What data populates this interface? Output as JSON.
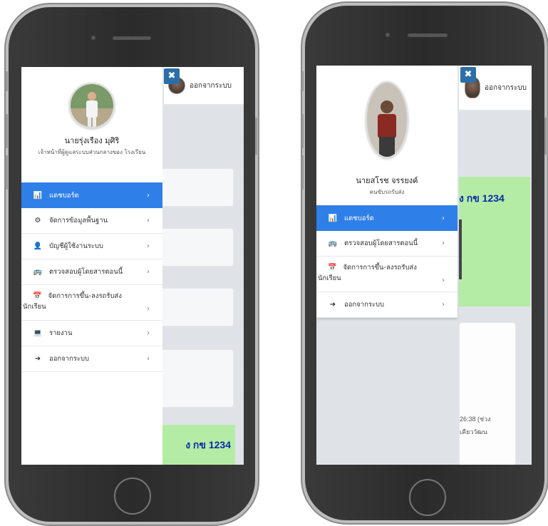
{
  "topbar": {
    "logout_label": "ออกจากระบบ"
  },
  "close_glyph": "✖",
  "left": {
    "profile": {
      "name": "นายรุ่งเรือง มุศิริ",
      "role": "เจ้าหน้าที่ผู้ดูแลระบบส่วนกลางของ โรงเรียน"
    },
    "menu": [
      {
        "icon": "chart-bar-icon",
        "glyph": "📊",
        "label": "แดชบอร์ด",
        "active": true
      },
      {
        "icon": "cogs-icon",
        "glyph": "⚙",
        "label": "จัดการข้อมูลพื้นฐาน",
        "active": false
      },
      {
        "icon": "user-icon",
        "glyph": "👤",
        "label": "บัญชีผู้ใช้งานระบบ",
        "active": false
      },
      {
        "icon": "users-check-icon",
        "glyph": "🚌",
        "label": "ตรวจสอบผู้โดยสารตอนนี้",
        "active": false
      },
      {
        "icon": "calendar-icon",
        "glyph": "📅",
        "label": "จัดการการขึ้น-ลงรถรับส่ง",
        "label2": "นักเรียน",
        "active": false
      },
      {
        "icon": "laptop-icon",
        "glyph": "💻",
        "label": "รายงาน",
        "active": false
      },
      {
        "icon": "sign-out-icon",
        "glyph": "➜",
        "label": "ออกจากระบบ",
        "active": false
      }
    ],
    "bg_text": "ง กข 1234"
  },
  "right": {
    "profile": {
      "name": "นายสโรช จรรยงค์",
      "role": "คนขับรถรับส่ง"
    },
    "menu": [
      {
        "icon": "chart-bar-icon",
        "glyph": "📊",
        "label": "แดชบอร์ด",
        "active": true
      },
      {
        "icon": "users-check-icon",
        "glyph": "🚌",
        "label": "ตรวจสอบผู้โดยสารตอนนี้",
        "active": false
      },
      {
        "icon": "calendar-icon",
        "glyph": "📅",
        "label": "จัดการการขึ้น-ลงรถรับส่ง",
        "label2": "นักเรียน",
        "active": false
      },
      {
        "icon": "sign-out-icon",
        "glyph": "➜",
        "label": "ออกจากระบบ",
        "active": false
      }
    ],
    "bg_text": "ง กข 1234",
    "bg_time": "26:38 (ช่วง",
    "bg_line2": "เคียววัฒน"
  },
  "chevron": "›"
}
